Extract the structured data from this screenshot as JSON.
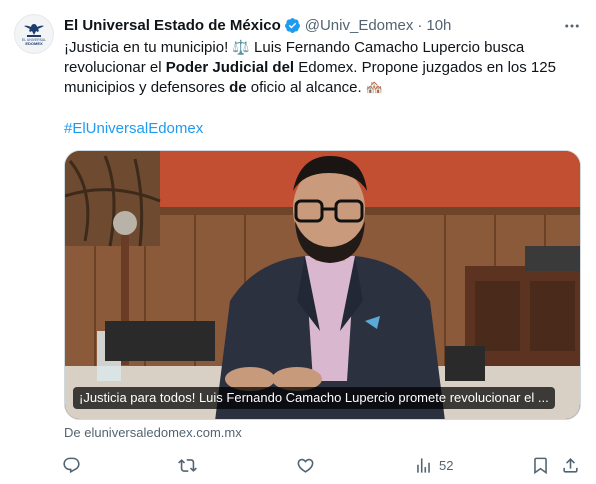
{
  "author": {
    "display_name": "El Universal Estado de México",
    "handle": "@Univ_Edomex",
    "separator": "·",
    "time": "10h",
    "avatar_logo_line1": "EL UNIVERSAL",
    "avatar_logo_line2": "EDOMEX",
    "verified": true
  },
  "tweet": {
    "text_part1": "¡Justicia en tu municipio! ",
    "emoji_scales": "⚖️",
    "text_part2": " Luis Fernando Camacho Lupercio busca revolucionar el ",
    "bold1": "Poder Judicial del",
    "text_part3": " Edomex. Propone juzgados en los 125 municipios y defensores ",
    "bold2": "de",
    "text_part4": " oficio al alcance. ",
    "emoji_houses": "🏘️",
    "hashtag": "#ElUniversalEdomex"
  },
  "card": {
    "caption": "¡Justicia para todos! Luis Fernando Camacho Lupercio promete revolucionar el ...",
    "source": "De eluniversaledomex.com.mx"
  },
  "actions": {
    "reply_count": "",
    "retweet_count": "",
    "like_count": "",
    "views_count": "52"
  },
  "icons": {
    "verified": "verified-badge-icon",
    "more": "more-icon",
    "reply": "reply-icon",
    "retweet": "retweet-icon",
    "like": "like-icon",
    "views": "views-icon",
    "bookmark": "bookmark-icon",
    "share": "share-icon"
  },
  "colors": {
    "link": "#1d9bf0",
    "secondary_text": "#536471",
    "verified": "#1d9bf0",
    "primary_text": "#0f1419"
  }
}
